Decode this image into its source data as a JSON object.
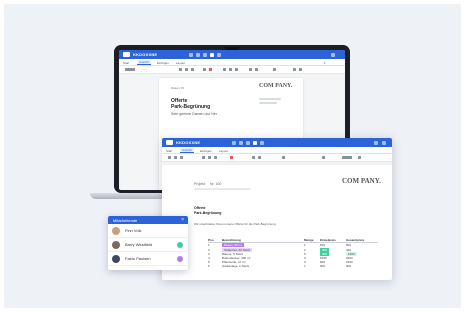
{
  "laptop_app": {
    "name": "KKDOXXNE",
    "menu": [
      "Start",
      "Ansicht",
      "Einfügen",
      "Layout"
    ],
    "active_menu": "Ansicht",
    "doc": {
      "date": "Datum 15",
      "title": "Offerte",
      "subtitle": "Park-Begrünung",
      "body": "Sehr geehrte Damen und Her"
    }
  },
  "doc_window": {
    "app_name": "KKDOXXNE",
    "menu": [
      "Start",
      "Ansicht",
      "Einfügen",
      "Layout"
    ],
    "active_menu": "Ansicht",
    "logo": "COM PANY.",
    "laptop_logo": "COM PANY.",
    "fields": {
      "label": "Projekt",
      "value": "Nr. 100"
    },
    "heading": "Offerte",
    "subheading": "Park-Begrünung",
    "intro": "Wir unterbreiten Ihnen unsere Offerte für die Park-Begrünung",
    "table": {
      "headers": [
        "Pos.",
        "Bezeichnung",
        "Menge",
        "Einzelpreis",
        "Gesamtpreis"
      ],
      "rows": [
        [
          "1",
          "Rasen, 50 m²",
          "1",
          "500",
          "500"
        ],
        [
          "2",
          "Sträucher, 20 Stück",
          "2",
          "200",
          "400"
        ],
        [
          "3",
          "Bäume, 5 Stück",
          "5",
          "300",
          "1500"
        ],
        [
          "4",
          "Bodendecker, 300 m²",
          "3",
          "1000",
          "3000"
        ],
        [
          "5",
          "Pflanzerde, 10 m³",
          "3",
          "800",
          "2400"
        ],
        [
          "6",
          "Gießanlage, 1 Stück",
          "1",
          "900",
          "900"
        ]
      ]
    }
  },
  "chat": {
    "title": "Mitarbeitende",
    "users": [
      {
        "name": "Finn Volk",
        "status": "none",
        "avatar_color": "#c9a07a"
      },
      {
        "name": "Barry Westfield",
        "status": "online",
        "avatar_color": "#7a6a5a"
      },
      {
        "name": "Fabio Paulsen",
        "status": "busy",
        "avatar_color": "#3b4a5e"
      }
    ]
  },
  "colors": {
    "accent": "#2d63d8",
    "highlight_purple": "#b77be8",
    "highlight_green": "#3fd0a0"
  }
}
